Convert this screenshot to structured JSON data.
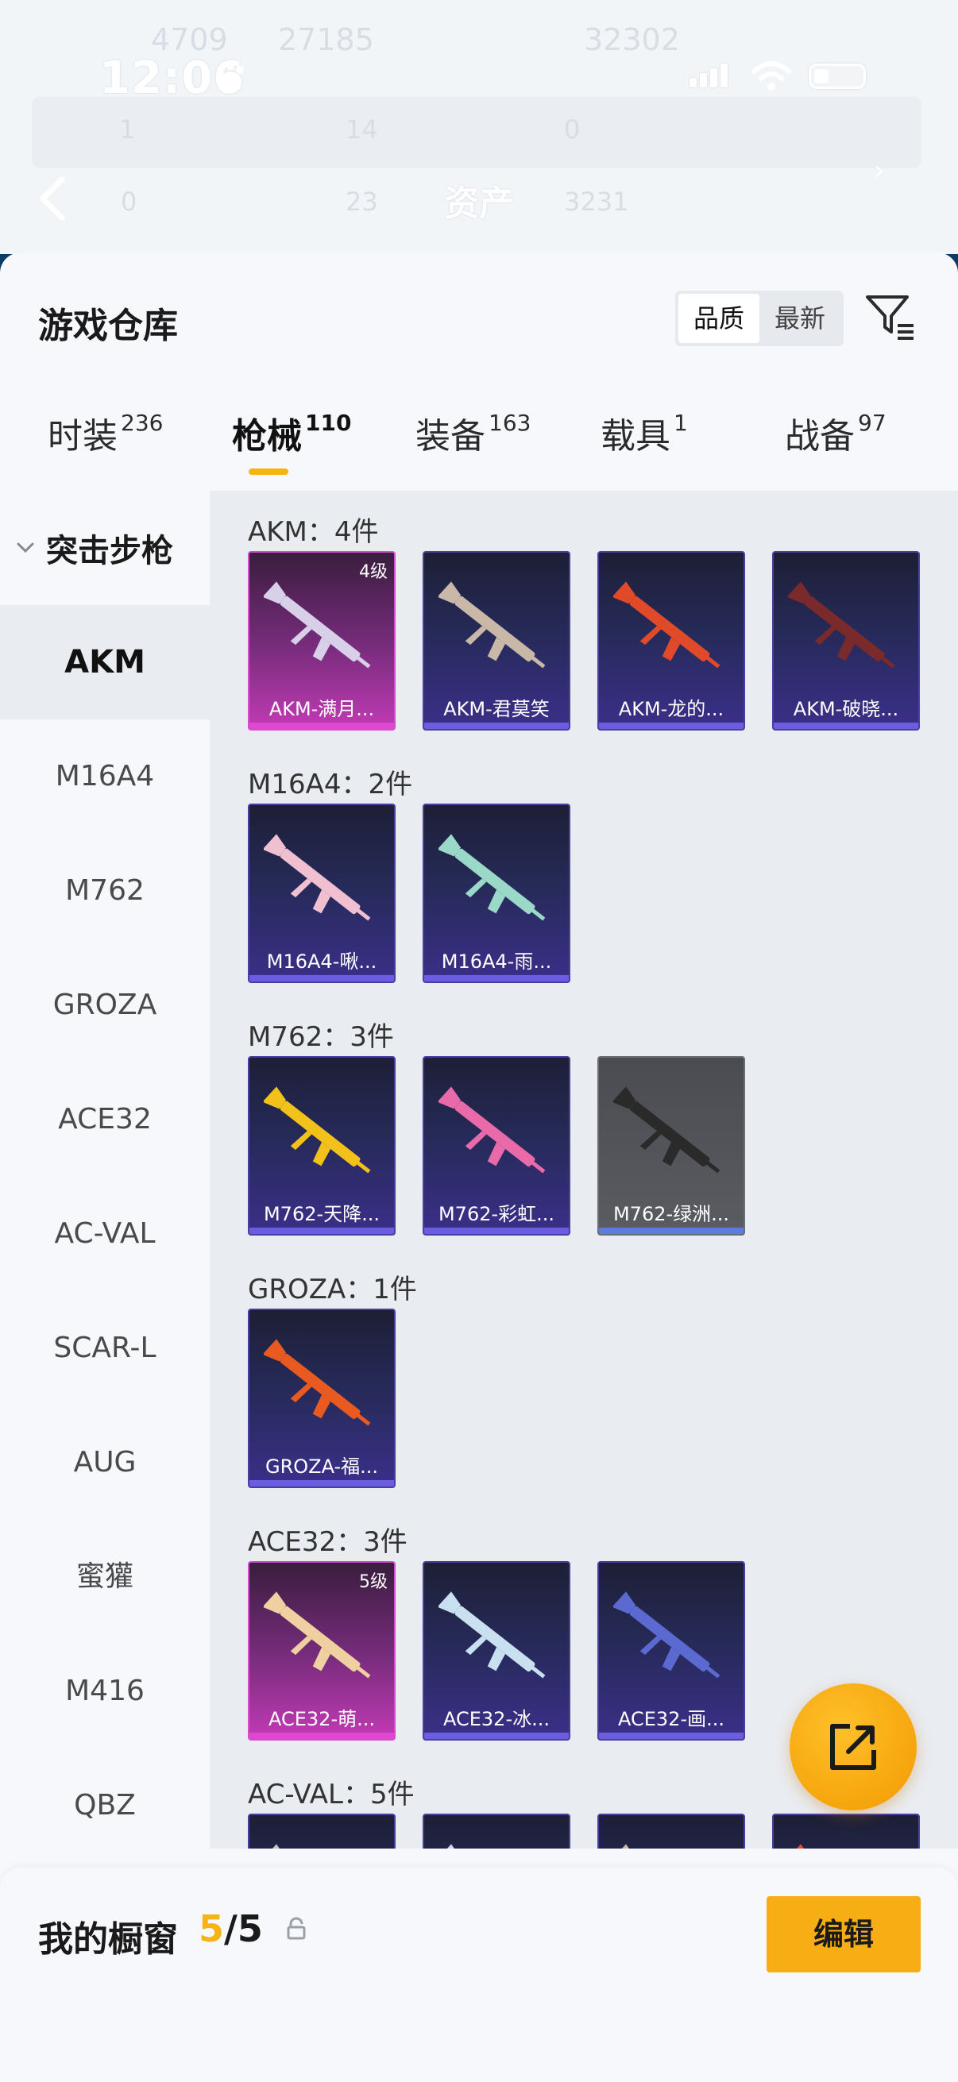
{
  "status_bar": {
    "time": "12:06"
  },
  "background_header": {
    "title": "资产",
    "ghost_values": [
      "4709",
      "27185",
      "32302"
    ],
    "row1": [
      "1",
      "14",
      "0"
    ],
    "row2": [
      "0",
      "23",
      "3231"
    ]
  },
  "sheet": {
    "title": "游戏仓库",
    "sort_options": [
      "品质",
      "最新"
    ],
    "sort_active": "品质"
  },
  "tabs": [
    {
      "label": "时装",
      "count": "236"
    },
    {
      "label": "枪械",
      "count": "110"
    },
    {
      "label": "装备",
      "count": "163"
    },
    {
      "label": "载具",
      "count": "1"
    },
    {
      "label": "战备",
      "count": "97"
    }
  ],
  "sidebar": {
    "category": "突击步枪",
    "items": [
      "AKM",
      "M16A4",
      "M762",
      "GROZA",
      "ACE32",
      "AC-VAL",
      "SCAR-L",
      "AUG",
      "蜜獾",
      "M416",
      "QBZ"
    ]
  },
  "groups": [
    {
      "title": "AKM：4件",
      "cards": [
        {
          "name": "AKM-满月...",
          "level": "4级",
          "rarity": "pink"
        },
        {
          "name": "AKM-君莫笑",
          "level": "",
          "rarity": "purple"
        },
        {
          "name": "AKM-龙的...",
          "level": "",
          "rarity": "purple"
        },
        {
          "name": "AKM-破晓...",
          "level": "",
          "rarity": "purple"
        }
      ]
    },
    {
      "title": "M16A4：2件",
      "cards": [
        {
          "name": "M16A4-啾...",
          "level": "",
          "rarity": "purple"
        },
        {
          "name": "M16A4-雨...",
          "level": "",
          "rarity": "purple"
        }
      ]
    },
    {
      "title": "M762：3件",
      "cards": [
        {
          "name": "M762-天降...",
          "level": "",
          "rarity": "purple"
        },
        {
          "name": "M762-彩虹...",
          "level": "",
          "rarity": "purple"
        },
        {
          "name": "M762-绿洲...",
          "level": "",
          "rarity": "gray"
        }
      ]
    },
    {
      "title": "GROZA：1件",
      "cards": [
        {
          "name": "GROZA-福...",
          "level": "",
          "rarity": "purple"
        }
      ]
    },
    {
      "title": "ACE32：3件",
      "cards": [
        {
          "name": "ACE32-萌...",
          "level": "5级",
          "rarity": "pink"
        },
        {
          "name": "ACE32-冰...",
          "level": "",
          "rarity": "purple"
        },
        {
          "name": "ACE32-画...",
          "level": "",
          "rarity": "purple"
        }
      ]
    },
    {
      "title": "AC-VAL：5件",
      "cards": [
        {
          "name": "",
          "level": "",
          "rarity": "purple"
        },
        {
          "name": "",
          "level": "",
          "rarity": "purple"
        },
        {
          "name": "",
          "level": "",
          "rarity": "purple"
        },
        {
          "name": "",
          "level": "",
          "rarity": "purple"
        }
      ]
    }
  ],
  "showcase": {
    "label": "我的橱窗",
    "current": "5",
    "separator": "/",
    "max": "5"
  },
  "edit_button": "编辑",
  "colors": {
    "accent": "#f7b314",
    "purple_card": "#3b2f8a",
    "pink_card": "#c23ab5"
  }
}
